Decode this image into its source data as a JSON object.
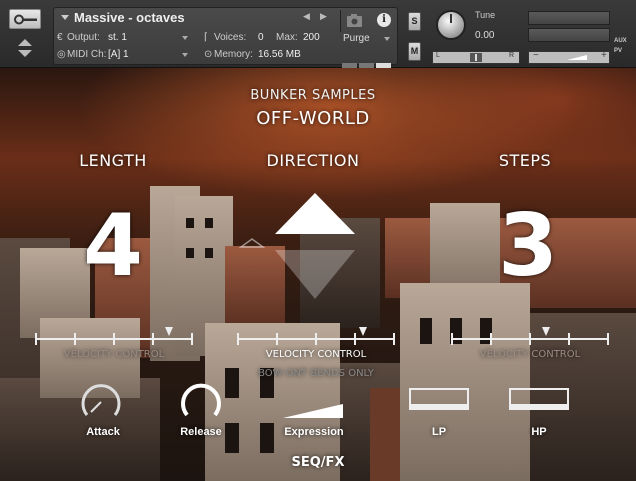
{
  "header": {
    "instrument_name": "Massive - octaves",
    "output_label": "Output:",
    "output_value": "st. 1",
    "voices_label": "Voices:",
    "voices_value": "0",
    "max_label": "Max:",
    "max_value": "200",
    "midi_label": "MIDI Ch:",
    "midi_value": "[A] 1",
    "memory_label": "Memory:",
    "memory_value": "16.56 MB",
    "purge_label": "Purge",
    "solo_label": "S",
    "mute_label": "M",
    "tune_label": "Tune",
    "tune_value": "0.00",
    "pan_left": "L",
    "pan_right": "R",
    "vol_minus": "−",
    "vol_plus": "+",
    "aux_label": "AUX",
    "pv_label": "PV"
  },
  "body": {
    "brand": "BUNKER SAMPLES",
    "title": "OFF-WORLD",
    "length": {
      "label": "LENGTH",
      "value": "4",
      "velocity_label": "VELOCITY CONTROL",
      "velocity": 0.85
    },
    "direction": {
      "label": "DIRECTION",
      "velocity_label": "VELOCITY CONTROL",
      "velocity": 0.8,
      "bow_label": "BOW ONT BENDS ONLY"
    },
    "steps": {
      "label": "STEPS",
      "value": "3",
      "velocity_label": "VELOCITY CONTROL",
      "velocity": 0.6
    },
    "attack_label": "Attack",
    "release_label": "Release",
    "expression_label": "Expression",
    "lp_label": "LP",
    "hp_label": "HP",
    "seqfx_label": "SEQ/FX"
  }
}
